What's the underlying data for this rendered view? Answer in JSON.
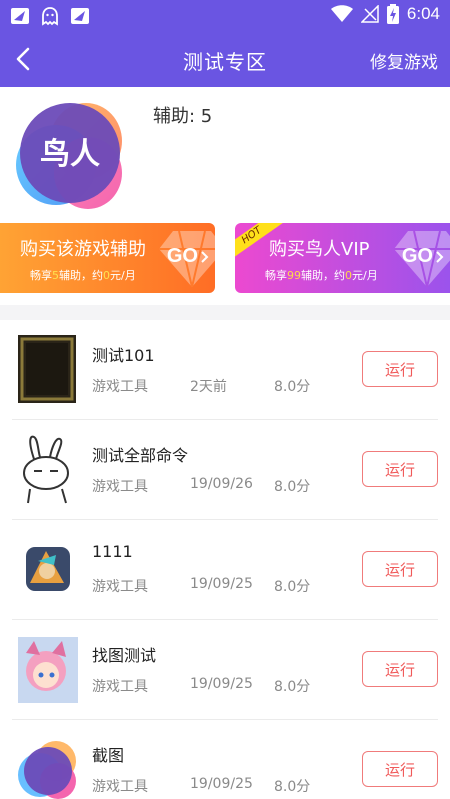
{
  "status_bar": {
    "time": "6:04",
    "left_icons": [
      "notification-app-icon",
      "ghost-icon",
      "notification-app-icon"
    ],
    "right_icons": [
      "wifi-icon",
      "no-signal-icon",
      "battery-charging-icon"
    ]
  },
  "navbar": {
    "title": "测试专区",
    "action_label": "修复游戏",
    "back_icon": "back-arrow-icon"
  },
  "profile": {
    "logo_text": "鸟人",
    "assist_count_label": "辅助: 5"
  },
  "promos": [
    {
      "title": "购买该游戏辅助",
      "sub_prefix": "畅享",
      "sub_highlight1": "5",
      "sub_mid": "辅助，约",
      "sub_highlight2": "0",
      "sub_suffix": "元/月",
      "go_label": "GO",
      "color_start": "#ffa334",
      "color_end": "#ff6d25"
    },
    {
      "tag": "HOT",
      "title": "购买鸟人VIP",
      "sub_prefix": "畅享",
      "sub_highlight1": "99",
      "sub_mid": "辅助，约",
      "sub_highlight2": "0",
      "sub_suffix": "元/月",
      "go_label": "GO",
      "color_start": "#ec49d0",
      "color_end": "#9b53ec"
    }
  ],
  "games": [
    {
      "title": "测试101",
      "category": "游戏工具",
      "date": "2天前",
      "score": "8.0分",
      "button": "运行"
    },
    {
      "title": "测试全部命令",
      "category": "游戏工具",
      "date": "19/09/26",
      "score": "8.0分",
      "button": "运行"
    },
    {
      "title": "1111",
      "category": "游戏工具",
      "date": "19/09/25",
      "score": "8.0分",
      "button": "运行"
    },
    {
      "title": "找图测试",
      "category": "游戏工具",
      "date": "19/09/25",
      "score": "8.0分",
      "button": "运行"
    },
    {
      "title": "截图",
      "category": "游戏工具",
      "date": "19/09/25",
      "score": "8.0分",
      "button": "运行"
    }
  ],
  "colors": {
    "primary": "#6a55e2",
    "run_button": "#f05a5a"
  }
}
